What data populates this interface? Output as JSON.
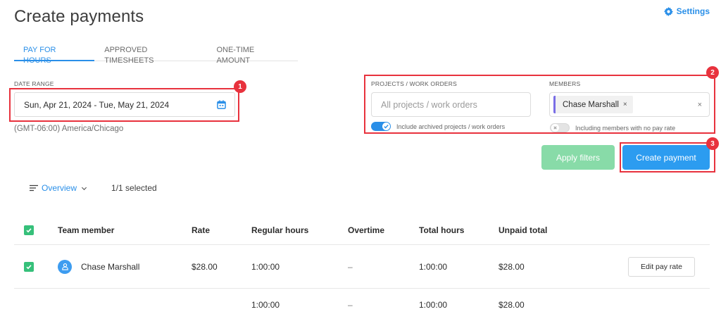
{
  "page": {
    "title": "Create payments",
    "settings_label": "Settings"
  },
  "tabs": [
    {
      "label": "PAY FOR HOURS",
      "active": true
    },
    {
      "label": "APPROVED TIMESHEETS",
      "active": false
    },
    {
      "label": "ONE-TIME AMOUNT",
      "active": false
    }
  ],
  "filters": {
    "date_range": {
      "label": "DATE RANGE",
      "value": "Sun, Apr 21, 2024 - Tue, May 21, 2024",
      "timezone": "(GMT-06:00) America/Chicago"
    },
    "projects": {
      "label": "PROJECTS / WORK ORDERS",
      "placeholder": "All projects / work orders",
      "archived_toggle_label": "Include archived projects / work orders",
      "archived_toggle_on": true
    },
    "members": {
      "label": "MEMBERS",
      "selected": [
        "Chase Marshall"
      ],
      "chip_remove": "×",
      "clear": "×",
      "no_pay_rate_toggle_label": "Including members with no pay rate",
      "no_pay_rate_toggle_on": false
    },
    "apply_label": "Apply filters",
    "create_label": "Create payment"
  },
  "annotations": {
    "markers": [
      "1",
      "2",
      "3"
    ],
    "color": "#e8323d"
  },
  "view": {
    "mode_label": "Overview",
    "selected_count": "1/1 selected"
  },
  "table": {
    "columns": [
      "Team member",
      "Rate",
      "Regular hours",
      "Overtime",
      "Total hours",
      "Unpaid total"
    ],
    "rows": [
      {
        "member": "Chase Marshall",
        "rate": "$28.00",
        "regular_hours": "1:00:00",
        "overtime": "–",
        "total_hours": "1:00:00",
        "unpaid_total": "$28.00",
        "action_label": "Edit pay rate"
      }
    ],
    "totals": {
      "regular_hours": "1:00:00",
      "overtime": "–",
      "total_hours": "1:00:00",
      "unpaid_total": "$28.00"
    }
  },
  "colors": {
    "accent": "#2a8fe8",
    "apply_button": "#88dba8",
    "create_button": "#2c9cf0",
    "checkbox": "#36c07a",
    "chip_accent": "#7a6ee6"
  },
  "icons": {
    "settings": "gear-icon",
    "calendar": "calendar-icon",
    "view": "lines-icon",
    "avatar": "user-avatar-icon"
  }
}
